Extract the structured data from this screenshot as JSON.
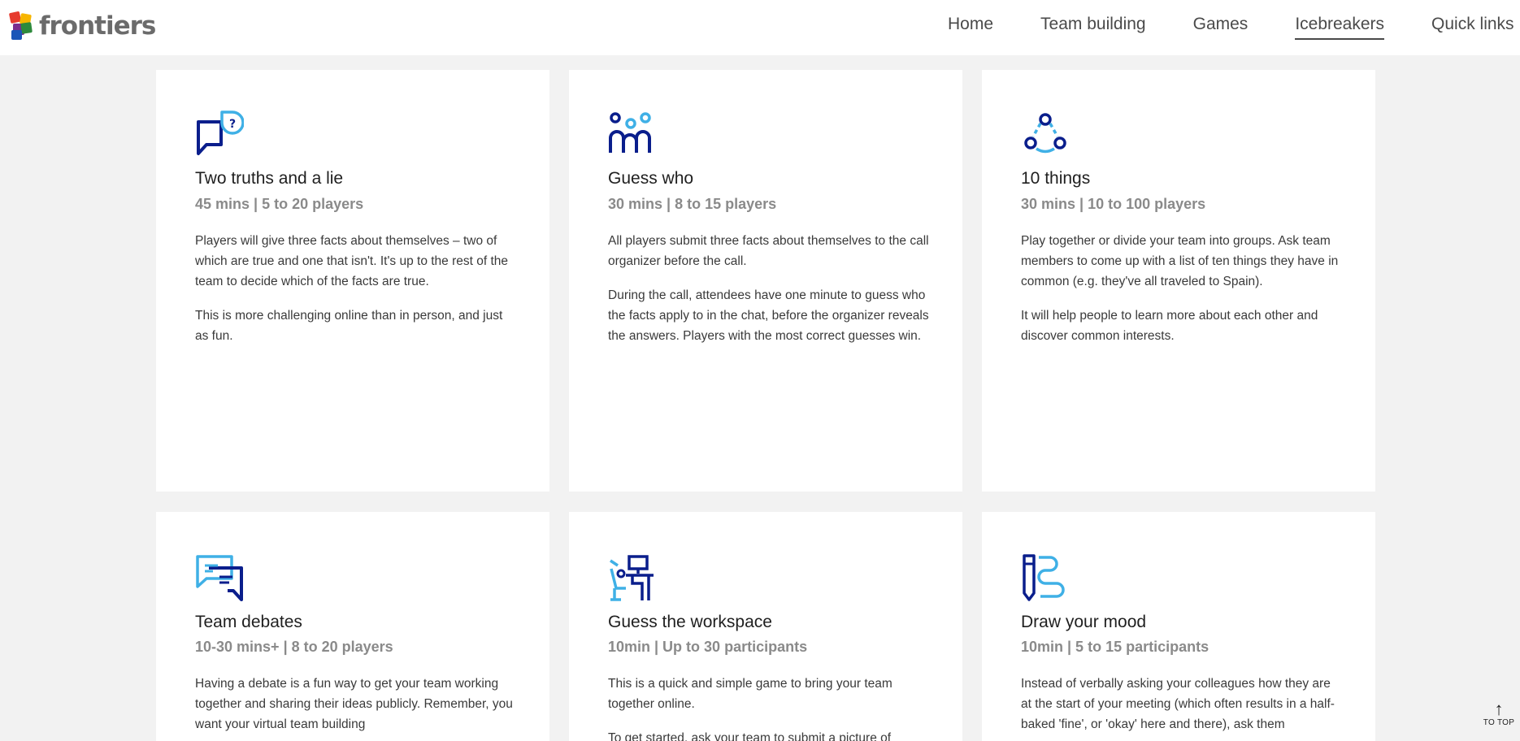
{
  "header": {
    "brand": "frontiers",
    "nav": [
      "Home",
      "Team building",
      "Games",
      "Icebreakers",
      "Quick links"
    ],
    "active_nav": "Icebreakers"
  },
  "cards": [
    {
      "title": "Two truths and a lie",
      "meta": "45 mins | 5 to 20 players",
      "icon": "chat-question-icon",
      "paragraphs": [
        "Players will give three facts about themselves – two of which are true and one that isn't. It's up to the rest of the team to decide which of the facts are true.",
        "This is more challenging online than in person, and just as fun."
      ]
    },
    {
      "title": "Guess who",
      "meta": "30 mins | 8 to 15 players",
      "icon": "people-group-icon",
      "paragraphs": [
        "All players submit three facts about themselves to the call organizer before the call.",
        "During the call, attendees have one minute to guess who the facts apply to in the chat, before the organizer reveals the answers. Players with the most correct guesses win."
      ]
    },
    {
      "title": "10 things",
      "meta": "30 mins | 10 to 100 players",
      "icon": "connected-circles-icon",
      "paragraphs": [
        "Play together or divide your team into groups. Ask team members to come up with a list of ten things they have in common (e.g. they've all traveled to Spain).",
        "It will help people to learn more about each other and discover common interests."
      ]
    },
    {
      "title": "Team debates",
      "meta": "10-30 mins+ | 8 to 20 players",
      "icon": "debate-bubbles-icon",
      "paragraphs": [
        "Having a debate is a fun way to get your team working together and sharing their ideas publicly. Remember, you want your virtual team building"
      ]
    },
    {
      "title": "Guess the workspace",
      "meta": "10min | Up to 30 participants",
      "icon": "workspace-desk-icon",
      "paragraphs": [
        "This is a quick and simple game to bring your team together online.",
        "To get started, ask your team to submit a picture of"
      ]
    },
    {
      "title": "Draw your mood",
      "meta": "10min | 5 to 15 participants",
      "icon": "pencil-squiggle-icon",
      "paragraphs": [
        "Instead of verbally asking your colleagues how they are at the start of your meeting (which often results in a half-baked 'fine', or 'okay' here and there), ask them"
      ]
    }
  ],
  "to_top": {
    "label": "TO TOP"
  },
  "colors": {
    "dark_blue": "#0a1e8c",
    "light_blue": "#3fb0e6",
    "page_bg": "#f2f2f2"
  }
}
